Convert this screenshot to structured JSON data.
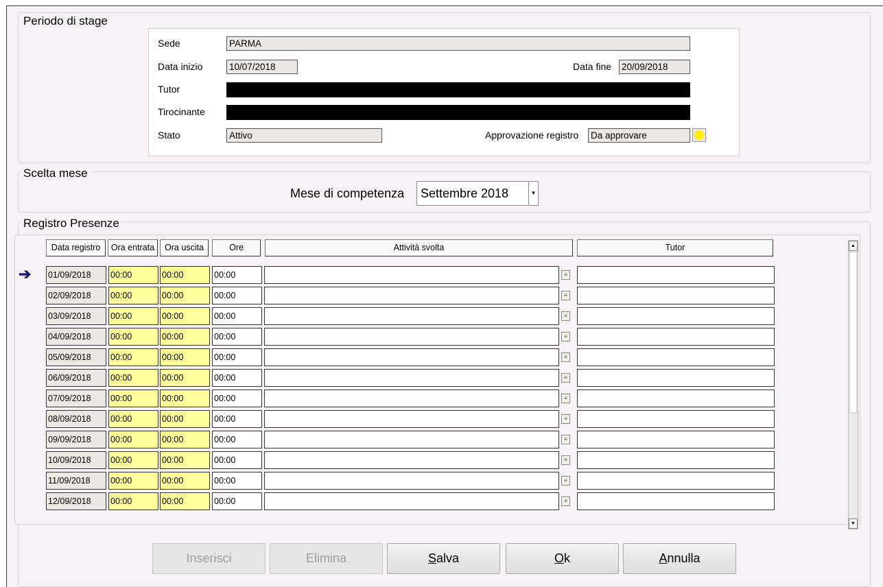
{
  "periodo": {
    "title": "Periodo di stage",
    "sede_label": "Sede",
    "sede_value": "PARMA",
    "data_inizio_label": "Data inizio",
    "data_inizio_value": "10/07/2018",
    "data_fine_label": "Data fine",
    "data_fine_value": "20/09/2018",
    "tutor_label": "Tutor",
    "tirocinante_label": "Tirocinante",
    "stato_label": "Stato",
    "stato_value": "Attivo",
    "approvazione_label": "Approvazione registro",
    "approvazione_value": "Da approvare",
    "status_color": "#ffee00"
  },
  "scelta": {
    "title": "Scelta mese",
    "mese_label": "Mese di competenza",
    "mese_value": "Settembre 2018"
  },
  "registro": {
    "title": "Registro Presenze",
    "headers": [
      "Data registro",
      "Ora entrata",
      "Ora uscita",
      "Ore",
      "Attività svolta",
      "Tutor"
    ],
    "rows": [
      {
        "data": "01/09/2018",
        "entrata": "00:00",
        "uscita": "00:00",
        "ore": "00:00"
      },
      {
        "data": "02/09/2018",
        "entrata": "00:00",
        "uscita": "00:00",
        "ore": "00:00"
      },
      {
        "data": "03/09/2018",
        "entrata": "00:00",
        "uscita": "00:00",
        "ore": "00:00"
      },
      {
        "data": "04/09/2018",
        "entrata": "00:00",
        "uscita": "00:00",
        "ore": "00:00"
      },
      {
        "data": "05/09/2018",
        "entrata": "00:00",
        "uscita": "00:00",
        "ore": "00:00"
      },
      {
        "data": "06/09/2018",
        "entrata": "00:00",
        "uscita": "00:00",
        "ore": "00:00"
      },
      {
        "data": "07/09/2018",
        "entrata": "00:00",
        "uscita": "00:00",
        "ore": "00:00"
      },
      {
        "data": "08/09/2018",
        "entrata": "00:00",
        "uscita": "00:00",
        "ore": "00:00"
      },
      {
        "data": "09/09/2018",
        "entrata": "00:00",
        "uscita": "00:00",
        "ore": "00:00"
      },
      {
        "data": "10/09/2018",
        "entrata": "00:00",
        "uscita": "00:00",
        "ore": "00:00"
      },
      {
        "data": "11/09/2018",
        "entrata": "00:00",
        "uscita": "00:00",
        "ore": "00:00"
      },
      {
        "data": "12/09/2018",
        "entrata": "00:00",
        "uscita": "00:00",
        "ore": "00:00"
      }
    ],
    "current_row_icon": "right-arrow-icon",
    "edit_icon": "edit-memo-icon",
    "yellow_color": "#ffff99"
  },
  "buttons": {
    "inserisci": "Inserisci",
    "elimina": "Elimina",
    "salva_u": "S",
    "salva_rest": "alva",
    "ok_u": "O",
    "ok_rest": "k",
    "annulla_u": "A",
    "annulla_rest": "nnulla"
  }
}
